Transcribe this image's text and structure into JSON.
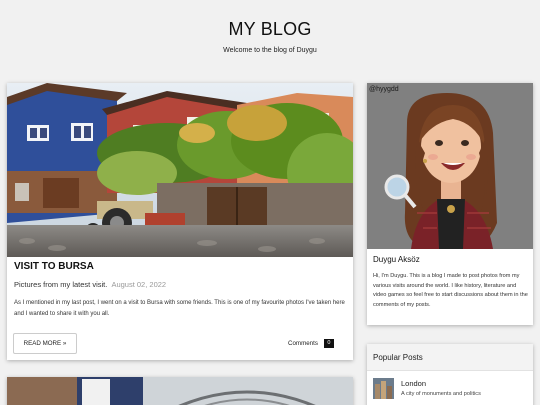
{
  "blog": {
    "title": "MY BLOG",
    "subtitle": "Welcome to the blog of Duygu"
  },
  "post": {
    "title": "VISIT TO BURSA",
    "subtitle": "Pictures from my latest visit.",
    "date": "August 02, 2022",
    "excerpt": "As I mentioned in my last post, I went on a visit to Bursa with some friends. This is one of my favourite photos I've taken here and I wanted to share it with you all.",
    "read_more_label": "READ MORE »",
    "comments_label": "Comments",
    "comments_count": "0"
  },
  "profile": {
    "name": "Duygu Aksöz",
    "bio": "Hi, I'm Duygu. This is a blog I made to post photos from my various visits around the world. I like history, literature and video games so feel free to start discussions about them in the comments of my posts.",
    "image_watermark": "@hyygdd"
  },
  "popular": {
    "header": "Popular Posts",
    "items": [
      {
        "title": "London",
        "description": "A city of monuments and politics"
      }
    ]
  },
  "colors": {
    "background": "#f1f1f1",
    "card": "#ffffff",
    "comment_badge": "#111111",
    "date_text": "#999999"
  }
}
